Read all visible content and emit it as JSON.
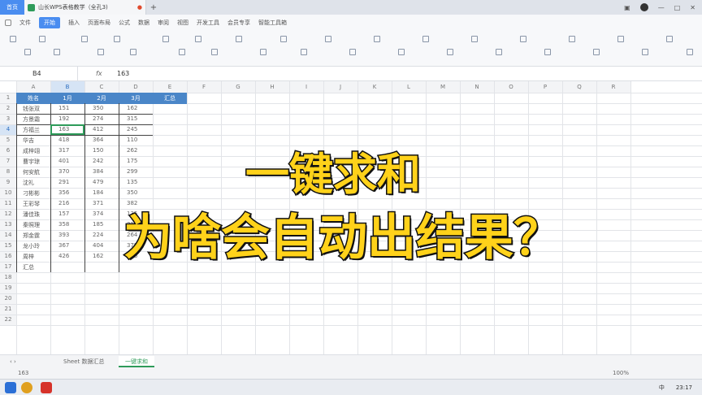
{
  "titlebar": {
    "home_tab": "首页",
    "doc_tab": "山长WPS表格教学（全孔3)",
    "plus": "+"
  },
  "menubar": {
    "items": [
      "文件",
      "开始",
      "插入",
      "页面布局",
      "公式",
      "数据",
      "审阅",
      "视图",
      "开发工具",
      "会员专享",
      "智能工具箱"
    ],
    "active": "开始"
  },
  "formula": {
    "cell_ref": "B4",
    "fx": "fx",
    "value": "163"
  },
  "columns": [
    "A",
    "B",
    "C",
    "D",
    "E",
    "F",
    "G",
    "H",
    "I",
    "J",
    "K",
    "L",
    "M",
    "N",
    "O",
    "P",
    "Q",
    "R"
  ],
  "rows": [
    "1",
    "2",
    "3",
    "4",
    "5",
    "6",
    "7",
    "8",
    "9",
    "10",
    "11",
    "12",
    "13",
    "14",
    "15",
    "16",
    "17",
    "18",
    "19",
    "20",
    "21",
    "22"
  ],
  "table": {
    "headers": [
      "姓名",
      "1月",
      "2月",
      "3月",
      "汇总"
    ],
    "data": [
      [
        "钱张双",
        "151",
        "350",
        "162"
      ],
      [
        "方景霜",
        "192",
        "274",
        "315"
      ],
      [
        "方福兰",
        "163",
        "412",
        "245"
      ],
      [
        "华吉",
        "418",
        "364",
        "110"
      ],
      [
        "成梓翊",
        "317",
        "150",
        "262"
      ],
      [
        "曹宇琼",
        "401",
        "242",
        "175"
      ],
      [
        "何安航",
        "370",
        "384",
        "299"
      ],
      [
        "沈礼",
        "291",
        "479",
        "135"
      ],
      [
        "刁彬彬",
        "356",
        "184",
        "350"
      ],
      [
        "王彩琴",
        "216",
        "371",
        "382"
      ],
      [
        "潘佳珠",
        "157",
        "374",
        "135"
      ],
      [
        "秦照理",
        "358",
        "185",
        "311"
      ],
      [
        "郑金霆",
        "393",
        "224",
        "264"
      ],
      [
        "龙小玲",
        "367",
        "404",
        "379"
      ],
      [
        "周梓",
        "426",
        "162",
        "216"
      ],
      [
        "汇总",
        "",
        "",
        ""
      ]
    ]
  },
  "overlay": {
    "line1": "一键求和",
    "line2": "为啥会自动出结果？"
  },
  "sheets": [
    "Sheet 数据汇总",
    "一键求和"
  ],
  "statusbar": {
    "value": "163",
    "zoom": "100%"
  },
  "taskbar": {
    "time": "23:17",
    "lang": "中"
  },
  "colors": {
    "accent": "#4a8df0",
    "header_fill": "#4a86c8",
    "overlay_text": "#ffd21a"
  }
}
